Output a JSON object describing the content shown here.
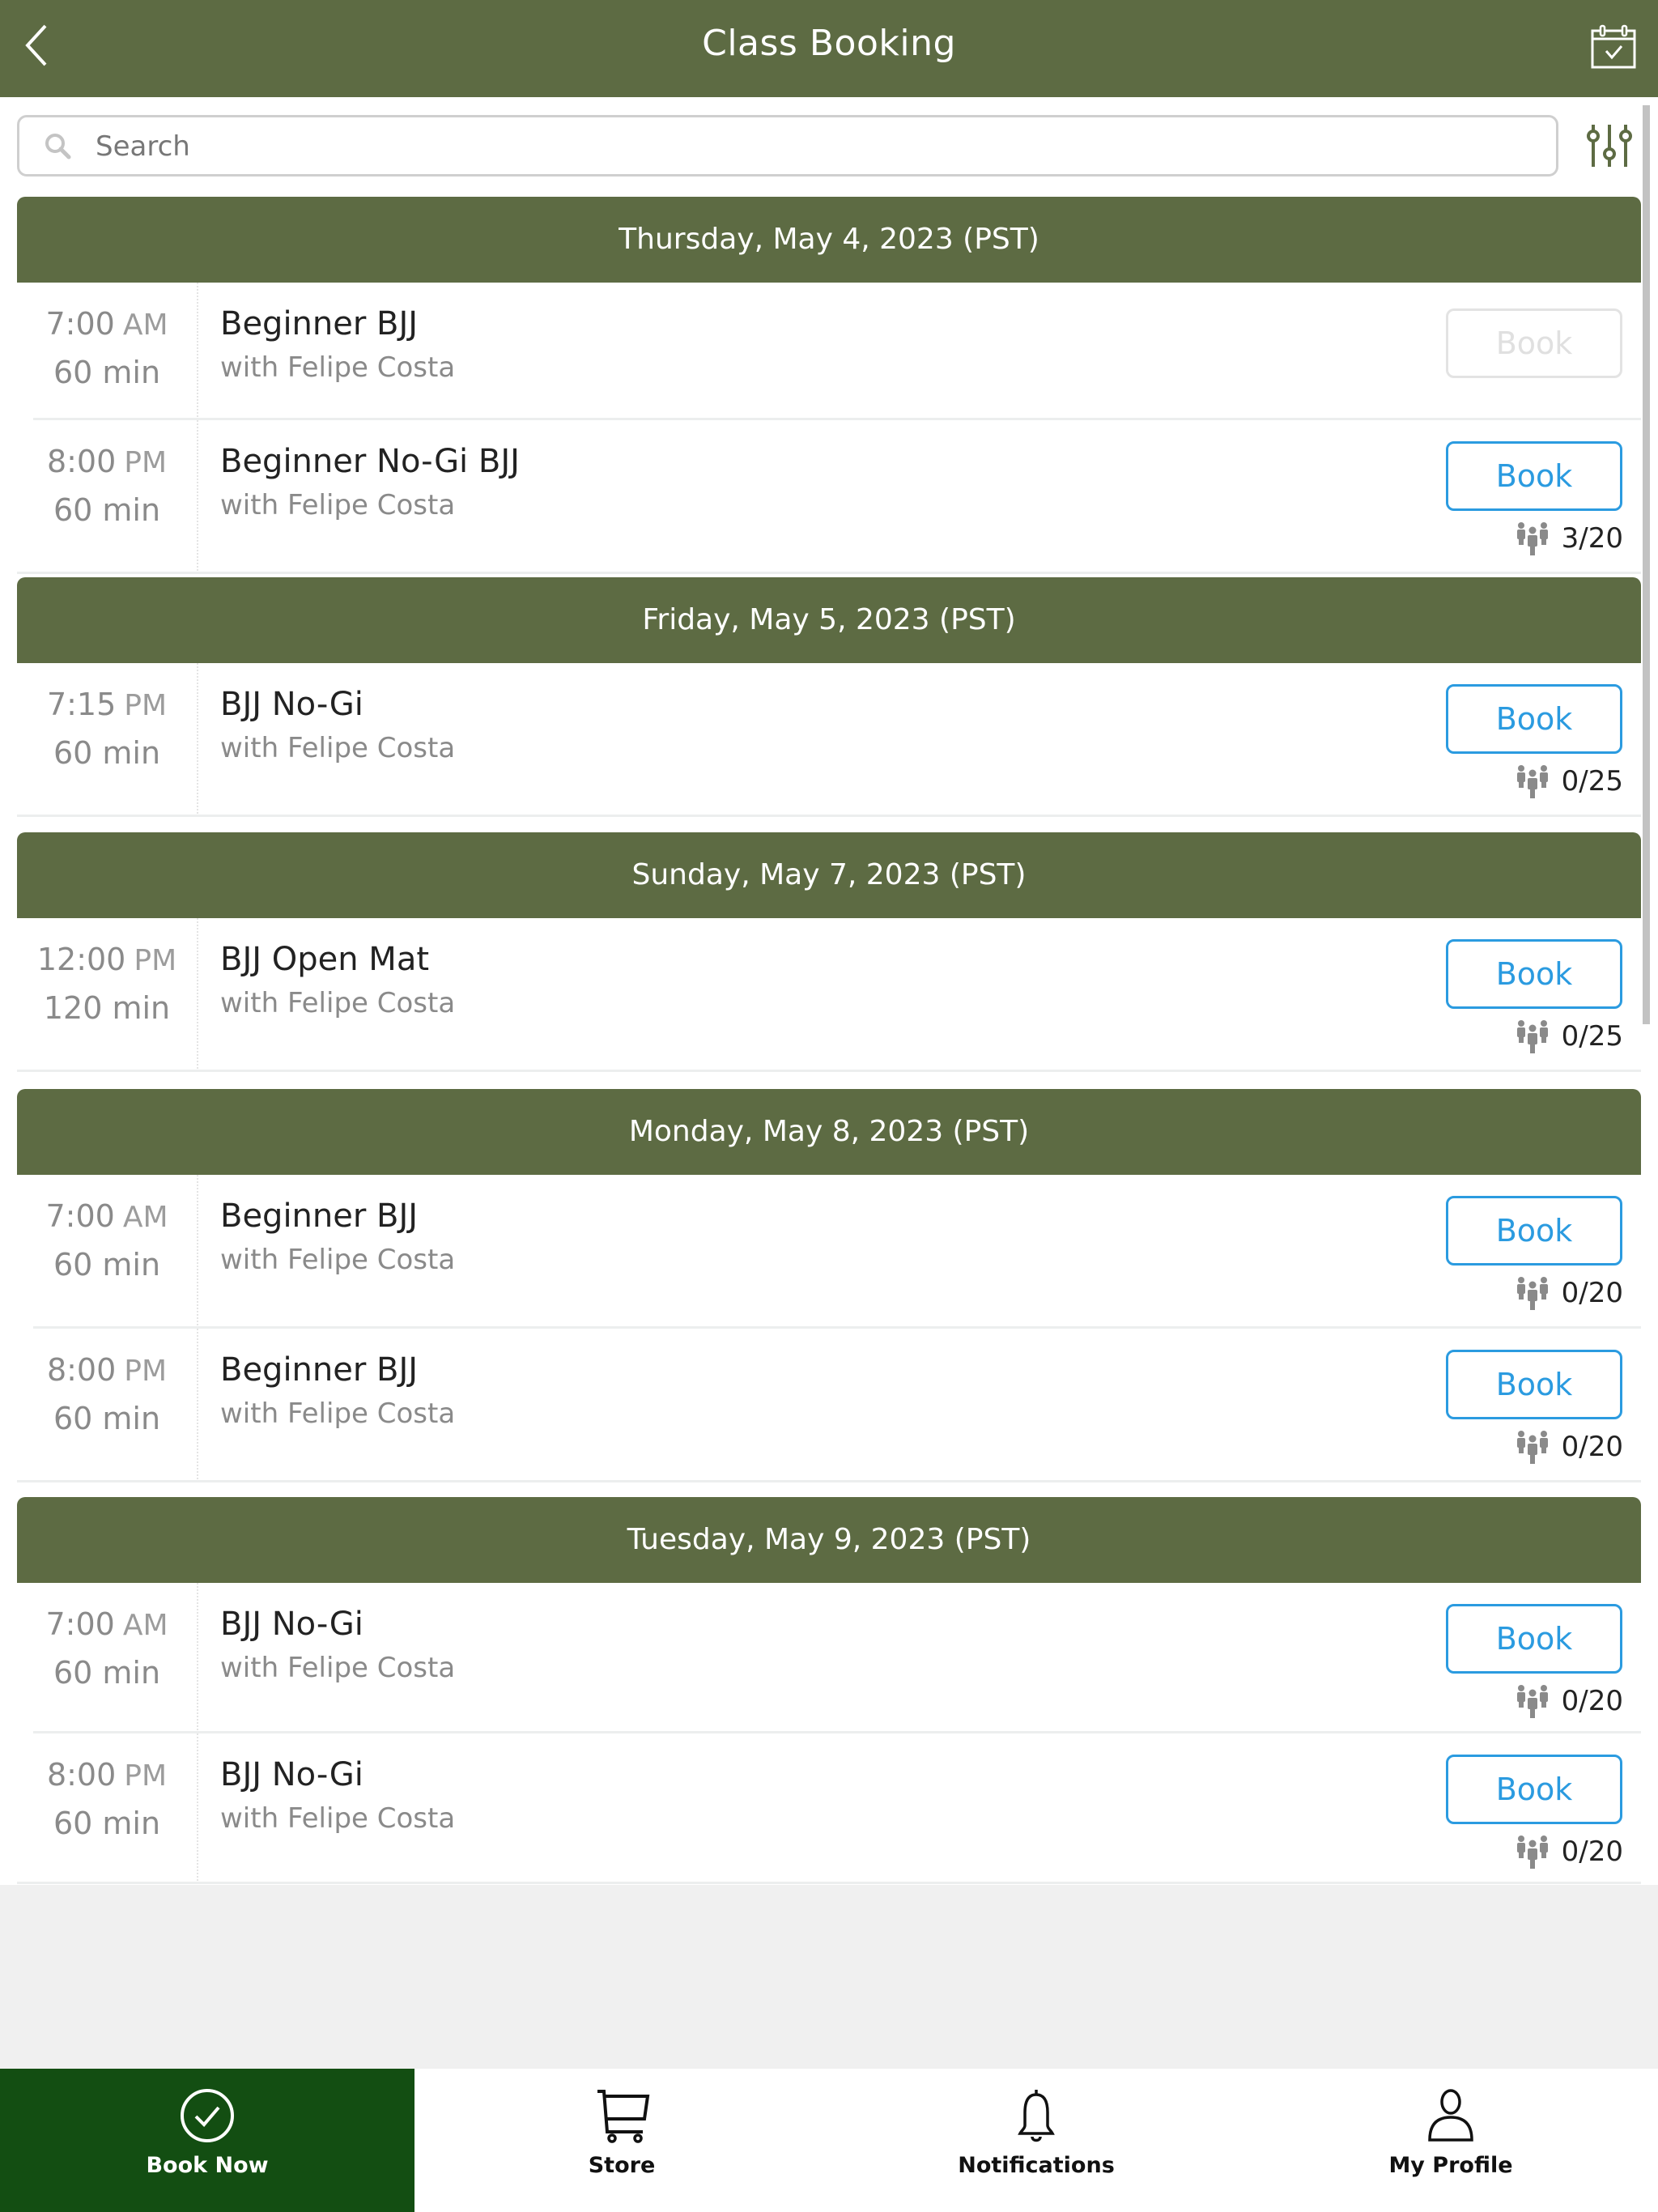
{
  "header": {
    "title": "Class Booking",
    "back_icon": "chevron-left-icon",
    "calendar_icon": "calendar-check-icon"
  },
  "search": {
    "placeholder": "Search",
    "value": "",
    "icon": "search-icon",
    "filter_icon": "sliders-icon"
  },
  "days": [
    {
      "date": "Thursday, May 4, 2023 (PST)",
      "classes": [
        {
          "time": "7:00",
          "ampm": "AM",
          "duration": "60 min",
          "name": "Beginner BJJ",
          "instructor": "with Felipe Costa",
          "book_label": "Book",
          "book_enabled": false,
          "capacity": ""
        },
        {
          "time": "8:00",
          "ampm": "PM",
          "duration": "60 min",
          "name": "Beginner No-Gi BJJ",
          "instructor": "with Felipe Costa",
          "book_label": "Book",
          "book_enabled": true,
          "capacity": "3/20"
        }
      ]
    },
    {
      "date": "Friday, May 5, 2023 (PST)",
      "classes": [
        {
          "time": "7:15",
          "ampm": "PM",
          "duration": "60 min",
          "name": "BJJ No-Gi",
          "instructor": "with Felipe Costa",
          "book_label": "Book",
          "book_enabled": true,
          "capacity": "0/25"
        }
      ]
    },
    {
      "date": "Sunday, May 7, 2023 (PST)",
      "classes": [
        {
          "time": "12:00",
          "ampm": "PM",
          "duration": "120 min",
          "name": "BJJ Open Mat",
          "instructor": "with Felipe Costa",
          "book_label": "Book",
          "book_enabled": true,
          "capacity": "0/25"
        }
      ]
    },
    {
      "date": "Monday, May 8, 2023 (PST)",
      "classes": [
        {
          "time": "7:00",
          "ampm": "AM",
          "duration": "60 min",
          "name": "Beginner BJJ",
          "instructor": "with Felipe Costa",
          "book_label": "Book",
          "book_enabled": true,
          "capacity": "0/20"
        },
        {
          "time": "8:00",
          "ampm": "PM",
          "duration": "60 min",
          "name": "Beginner BJJ",
          "instructor": "with Felipe Costa",
          "book_label": "Book",
          "book_enabled": true,
          "capacity": "0/20"
        }
      ]
    },
    {
      "date": "Tuesday, May 9, 2023 (PST)",
      "classes": [
        {
          "time": "7:00",
          "ampm": "AM",
          "duration": "60 min",
          "name": "BJJ No-Gi",
          "instructor": "with Felipe Costa",
          "book_label": "Book",
          "book_enabled": true,
          "capacity": "0/20"
        },
        {
          "time": "8:00",
          "ampm": "PM",
          "duration": "60 min",
          "name": "BJJ No-Gi",
          "instructor": "with Felipe Costa",
          "book_label": "Book",
          "book_enabled": true,
          "capacity": "0/20"
        }
      ]
    }
  ],
  "bottom_nav": [
    {
      "label": "Book Now",
      "icon": "check-circle-icon",
      "active": true
    },
    {
      "label": "Store",
      "icon": "cart-icon",
      "active": false
    },
    {
      "label": "Notifications",
      "icon": "bell-icon",
      "active": false
    },
    {
      "label": "My Profile",
      "icon": "user-icon",
      "active": false
    }
  ],
  "colors": {
    "header_bg": "#5d6b43",
    "day_header_bg": "#5d6b43",
    "active_tab_bg": "#134e12",
    "book_button": "#2b9be0",
    "page_bg": "#f0f0f0"
  }
}
